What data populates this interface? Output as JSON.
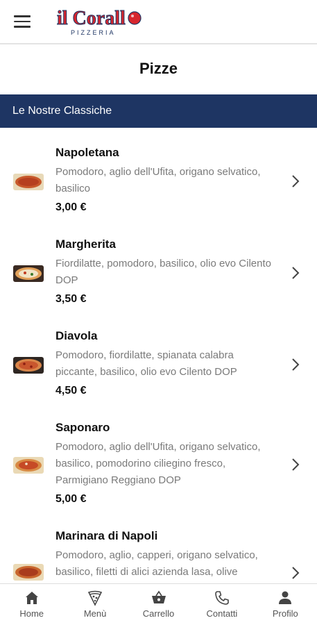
{
  "header": {
    "logo_text": "Il Corallo",
    "logo_sub": "PIZZERIA"
  },
  "page": {
    "title": "Pizze"
  },
  "section": {
    "title": "Le Nostre Classiche"
  },
  "items": [
    {
      "name": "Napoletana",
      "desc": "Pomodoro, aglio dell'Ufita, origano selvatico, basilico",
      "price": "3,00 €"
    },
    {
      "name": "Margherita",
      "desc": "Fiordilatte, pomodoro, basilico, olio evo Cilento DOP",
      "price": "3,50 €"
    },
    {
      "name": "Diavola",
      "desc": "Pomodoro, fiordilatte, spianata calabra piccante, basilico, olio evo Cilento DOP",
      "price": "4,50 €"
    },
    {
      "name": "Saponaro",
      "desc": "Pomodoro, aglio dell'Ufita, origano selvatico, basilico, pomodorino ciliegino fresco, Parmigiano Reggiano DOP",
      "price": "5,00 €"
    },
    {
      "name": "Marinara di Napoli",
      "desc": "Pomodoro, aglio, capperi, origano selvatico, basilico, filetti di alici azienda lasa, olive",
      "price": ""
    }
  ],
  "nav": [
    {
      "label": "Home",
      "icon": "home-icon"
    },
    {
      "label": "Menù",
      "icon": "pizza-slice-icon"
    },
    {
      "label": "Carrello",
      "icon": "basket-icon"
    },
    {
      "label": "Contatti",
      "icon": "phone-icon"
    },
    {
      "label": "Profilo",
      "icon": "user-icon"
    }
  ]
}
